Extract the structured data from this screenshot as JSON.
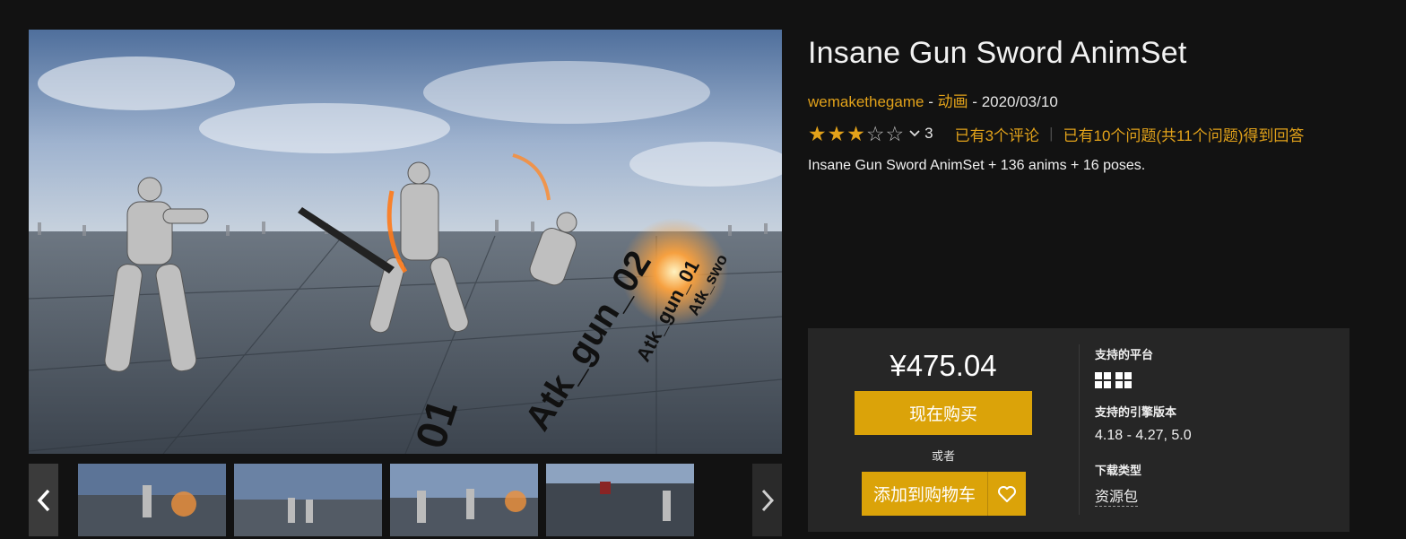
{
  "product": {
    "title": "Insane Gun Sword AnimSet",
    "author": "wemakethegame",
    "meta_sep1": " - ",
    "category": "动画",
    "meta_sep2": " - ",
    "date": "2020/03/10",
    "rating": {
      "stars_filled": 3,
      "stars_total": 5,
      "count": "3",
      "chevron_icon": "chevron-down-icon"
    },
    "reviews_link": "已有3个评论",
    "questions_link": "已有10个问题(共11个问题)得到回答",
    "description": "Insane Gun Sword AnimSet + 136 anims + 16 poses."
  },
  "gallery": {
    "hero_text": {
      "line1": "01",
      "line2": "Atk_gun_02",
      "line3": "Atk_gun_01",
      "line4": "Atk_swo"
    },
    "prev_icon": "chevron-left-icon",
    "next_icon": "chevron-right-icon",
    "thumbnails": 4,
    "active_thumbnail": 3
  },
  "purchase": {
    "price": "¥475.04",
    "buy_now": "现在购买",
    "or": "或者",
    "add_to_cart": "添加到购物车",
    "wishlist_icon": "heart-icon"
  },
  "specs": {
    "platform_label": "支持的平台",
    "platform_icons": [
      "windows-icon",
      "windows-icon"
    ],
    "engine_label": "支持的引擎版本",
    "engine_value": "4.18 - 4.27, 5.0",
    "download_label": "下载类型",
    "download_value": "资源包"
  },
  "colors": {
    "accent": "#e2a21a",
    "button": "#dba309",
    "background": "#121212",
    "panel": "#262626"
  }
}
